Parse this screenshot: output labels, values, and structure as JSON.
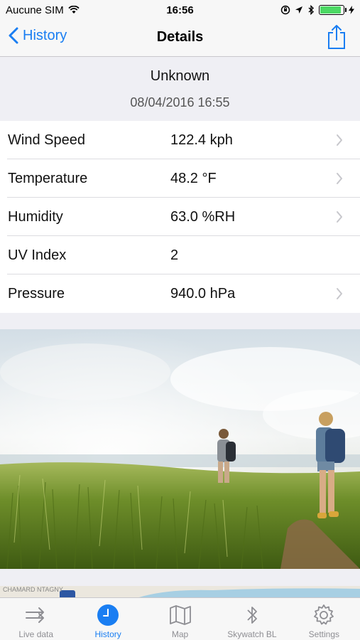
{
  "status_bar": {
    "carrier": "Aucune SIM",
    "time": "16:56",
    "battery_level": 0.9
  },
  "nav": {
    "back_label": "History",
    "title": "Details"
  },
  "header": {
    "location": "Unknown",
    "datetime": "08/04/2016 16:55"
  },
  "readings": [
    {
      "label": "Wind Speed",
      "value": "122.4 kph",
      "has_chevron": true
    },
    {
      "label": "Temperature",
      "value": "48.2 °F",
      "has_chevron": true
    },
    {
      "label": "Humidity",
      "value": "63.0 %RH",
      "has_chevron": true
    },
    {
      "label": "UV Index",
      "value": "2",
      "has_chevron": false
    },
    {
      "label": "Pressure",
      "value": "940.0 hPa",
      "has_chevron": true
    }
  ],
  "map_strip": {
    "text": "CHAMARD NTAGNY"
  },
  "tab_bar": {
    "tabs": [
      {
        "label": "Live data",
        "icon": "live-data-icon",
        "active": false
      },
      {
        "label": "History",
        "icon": "history-icon",
        "active": true
      },
      {
        "label": "Map",
        "icon": "map-icon",
        "active": false
      },
      {
        "label": "Skywatch BL",
        "icon": "bluetooth-icon",
        "active": false
      },
      {
        "label": "Settings",
        "icon": "gear-icon",
        "active": false
      }
    ]
  },
  "colors": {
    "accent": "#1a7ef2",
    "background": "#efeff4",
    "tab_inactive": "#8e8e93",
    "battery": "#4cd964"
  }
}
